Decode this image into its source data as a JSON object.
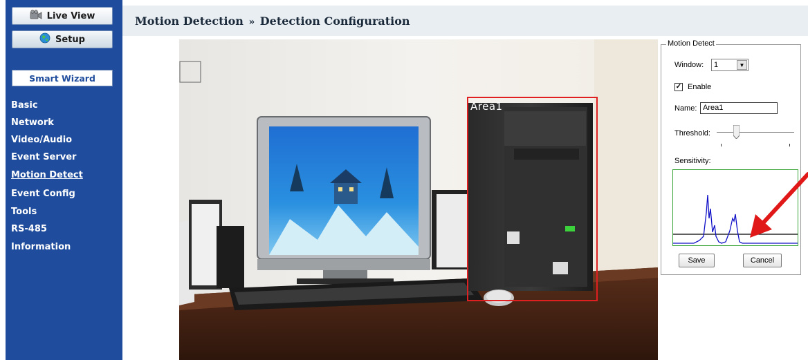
{
  "sidebar": {
    "live_view": "Live View",
    "setup": "Setup",
    "smart_wizard": "Smart Wizard",
    "items": [
      {
        "label": "Basic",
        "active": false
      },
      {
        "label": "Network",
        "active": false
      },
      {
        "label": "Video/Audio",
        "active": false
      },
      {
        "label": "Event Server",
        "active": false
      },
      {
        "label": "Motion Detect",
        "active": true
      },
      {
        "label": "Event Config",
        "active": false
      },
      {
        "label": "Tools",
        "active": false
      },
      {
        "label": "RS-485",
        "active": false
      },
      {
        "label": "Information",
        "active": false
      }
    ]
  },
  "header": {
    "section": "Motion Detection",
    "separator": "»",
    "page": "Detection Configuration"
  },
  "video": {
    "area_label": "Area1"
  },
  "panel": {
    "legend": "Motion Detect",
    "window_label": "Window:",
    "window_value": "1",
    "enable_label": "Enable",
    "enable_checked": true,
    "name_label": "Name:",
    "name_value": "Area1",
    "threshold_label": "Threshold:",
    "threshold_level": 0.22,
    "sensitivity_label": "Sensitivity:",
    "save_label": "Save",
    "cancel_label": "Cancel"
  },
  "colors": {
    "sidebar_bg": "#1f4c9c",
    "header_bg": "#e9eef3",
    "area_box": "#e02020",
    "annotation_arrow": "#e01818",
    "graph_border": "#3aa53a",
    "graph_line": "#1010c8"
  },
  "icons": {
    "live_view": "camera-icon",
    "setup": "globe-icon",
    "window_select": "dropdown-arrow-icon",
    "enable": "checkmark-icon",
    "annotation": "red-arrow-icon"
  }
}
